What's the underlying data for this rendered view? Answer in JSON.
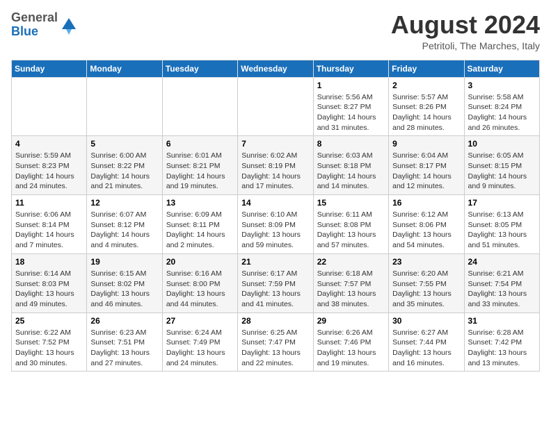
{
  "header": {
    "logo": {
      "general": "General",
      "blue": "Blue"
    },
    "month_title": "August 2024",
    "location": "Petritoli, The Marches, Italy"
  },
  "days_of_week": [
    "Sunday",
    "Monday",
    "Tuesday",
    "Wednesday",
    "Thursday",
    "Friday",
    "Saturday"
  ],
  "weeks": [
    {
      "days": [
        {
          "num": "",
          "info": ""
        },
        {
          "num": "",
          "info": ""
        },
        {
          "num": "",
          "info": ""
        },
        {
          "num": "",
          "info": ""
        },
        {
          "num": "1",
          "info": "Sunrise: 5:56 AM\nSunset: 8:27 PM\nDaylight: 14 hours\nand 31 minutes."
        },
        {
          "num": "2",
          "info": "Sunrise: 5:57 AM\nSunset: 8:26 PM\nDaylight: 14 hours\nand 28 minutes."
        },
        {
          "num": "3",
          "info": "Sunrise: 5:58 AM\nSunset: 8:24 PM\nDaylight: 14 hours\nand 26 minutes."
        }
      ]
    },
    {
      "days": [
        {
          "num": "4",
          "info": "Sunrise: 5:59 AM\nSunset: 8:23 PM\nDaylight: 14 hours\nand 24 minutes."
        },
        {
          "num": "5",
          "info": "Sunrise: 6:00 AM\nSunset: 8:22 PM\nDaylight: 14 hours\nand 21 minutes."
        },
        {
          "num": "6",
          "info": "Sunrise: 6:01 AM\nSunset: 8:21 PM\nDaylight: 14 hours\nand 19 minutes."
        },
        {
          "num": "7",
          "info": "Sunrise: 6:02 AM\nSunset: 8:19 PM\nDaylight: 14 hours\nand 17 minutes."
        },
        {
          "num": "8",
          "info": "Sunrise: 6:03 AM\nSunset: 8:18 PM\nDaylight: 14 hours\nand 14 minutes."
        },
        {
          "num": "9",
          "info": "Sunrise: 6:04 AM\nSunset: 8:17 PM\nDaylight: 14 hours\nand 12 minutes."
        },
        {
          "num": "10",
          "info": "Sunrise: 6:05 AM\nSunset: 8:15 PM\nDaylight: 14 hours\nand 9 minutes."
        }
      ]
    },
    {
      "days": [
        {
          "num": "11",
          "info": "Sunrise: 6:06 AM\nSunset: 8:14 PM\nDaylight: 14 hours\nand 7 minutes."
        },
        {
          "num": "12",
          "info": "Sunrise: 6:07 AM\nSunset: 8:12 PM\nDaylight: 14 hours\nand 4 minutes."
        },
        {
          "num": "13",
          "info": "Sunrise: 6:09 AM\nSunset: 8:11 PM\nDaylight: 14 hours\nand 2 minutes."
        },
        {
          "num": "14",
          "info": "Sunrise: 6:10 AM\nSunset: 8:09 PM\nDaylight: 13 hours\nand 59 minutes."
        },
        {
          "num": "15",
          "info": "Sunrise: 6:11 AM\nSunset: 8:08 PM\nDaylight: 13 hours\nand 57 minutes."
        },
        {
          "num": "16",
          "info": "Sunrise: 6:12 AM\nSunset: 8:06 PM\nDaylight: 13 hours\nand 54 minutes."
        },
        {
          "num": "17",
          "info": "Sunrise: 6:13 AM\nSunset: 8:05 PM\nDaylight: 13 hours\nand 51 minutes."
        }
      ]
    },
    {
      "days": [
        {
          "num": "18",
          "info": "Sunrise: 6:14 AM\nSunset: 8:03 PM\nDaylight: 13 hours\nand 49 minutes."
        },
        {
          "num": "19",
          "info": "Sunrise: 6:15 AM\nSunset: 8:02 PM\nDaylight: 13 hours\nand 46 minutes."
        },
        {
          "num": "20",
          "info": "Sunrise: 6:16 AM\nSunset: 8:00 PM\nDaylight: 13 hours\nand 44 minutes."
        },
        {
          "num": "21",
          "info": "Sunrise: 6:17 AM\nSunset: 7:59 PM\nDaylight: 13 hours\nand 41 minutes."
        },
        {
          "num": "22",
          "info": "Sunrise: 6:18 AM\nSunset: 7:57 PM\nDaylight: 13 hours\nand 38 minutes."
        },
        {
          "num": "23",
          "info": "Sunrise: 6:20 AM\nSunset: 7:55 PM\nDaylight: 13 hours\nand 35 minutes."
        },
        {
          "num": "24",
          "info": "Sunrise: 6:21 AM\nSunset: 7:54 PM\nDaylight: 13 hours\nand 33 minutes."
        }
      ]
    },
    {
      "days": [
        {
          "num": "25",
          "info": "Sunrise: 6:22 AM\nSunset: 7:52 PM\nDaylight: 13 hours\nand 30 minutes."
        },
        {
          "num": "26",
          "info": "Sunrise: 6:23 AM\nSunset: 7:51 PM\nDaylight: 13 hours\nand 27 minutes."
        },
        {
          "num": "27",
          "info": "Sunrise: 6:24 AM\nSunset: 7:49 PM\nDaylight: 13 hours\nand 24 minutes."
        },
        {
          "num": "28",
          "info": "Sunrise: 6:25 AM\nSunset: 7:47 PM\nDaylight: 13 hours\nand 22 minutes."
        },
        {
          "num": "29",
          "info": "Sunrise: 6:26 AM\nSunset: 7:46 PM\nDaylight: 13 hours\nand 19 minutes."
        },
        {
          "num": "30",
          "info": "Sunrise: 6:27 AM\nSunset: 7:44 PM\nDaylight: 13 hours\nand 16 minutes."
        },
        {
          "num": "31",
          "info": "Sunrise: 6:28 AM\nSunset: 7:42 PM\nDaylight: 13 hours\nand 13 minutes."
        }
      ]
    }
  ]
}
